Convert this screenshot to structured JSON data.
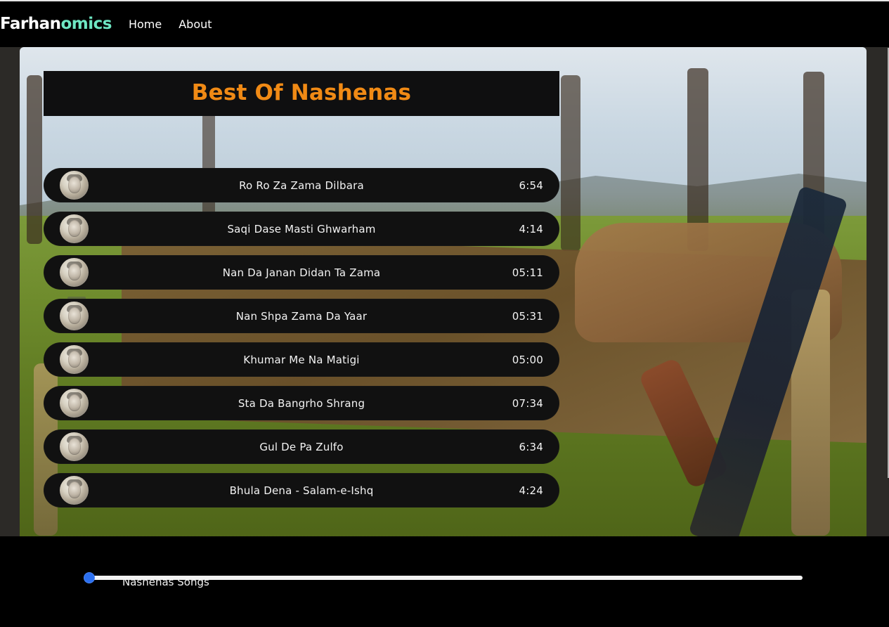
{
  "navbar": {
    "brand_part1": "Farhan",
    "brand_part2": "omics",
    "links": [
      "Home",
      "About"
    ],
    "brand_colors": {
      "part1": "#ffffff",
      "part2": "#6ee7c3"
    }
  },
  "page": {
    "title": "Best Of Nashenas",
    "title_color": "#f08a15"
  },
  "tracks": [
    {
      "title": "Ro Ro Za Zama Dilbara",
      "duration": "6:54"
    },
    {
      "title": "Saqi Dase Masti Ghwarham",
      "duration": "4:14"
    },
    {
      "title": "Nan Da Janan Didan Ta Zama",
      "duration": "05:11"
    },
    {
      "title": "Nan Shpa Zama Da Yaar",
      "duration": "05:31"
    },
    {
      "title": "Khumar Me Na Matigi",
      "duration": "05:00"
    },
    {
      "title": "Sta Da Bangrho Shrang",
      "duration": "07:34"
    },
    {
      "title": "Gul De Pa Zulfo",
      "duration": "6:34"
    },
    {
      "title": "Bhula Dena - Salam-e-Ishq",
      "duration": "4:24"
    }
  ],
  "player": {
    "now_playing": "Nashenas Songs",
    "progress_fraction": 0.0,
    "accent": "#2b6ff0"
  }
}
